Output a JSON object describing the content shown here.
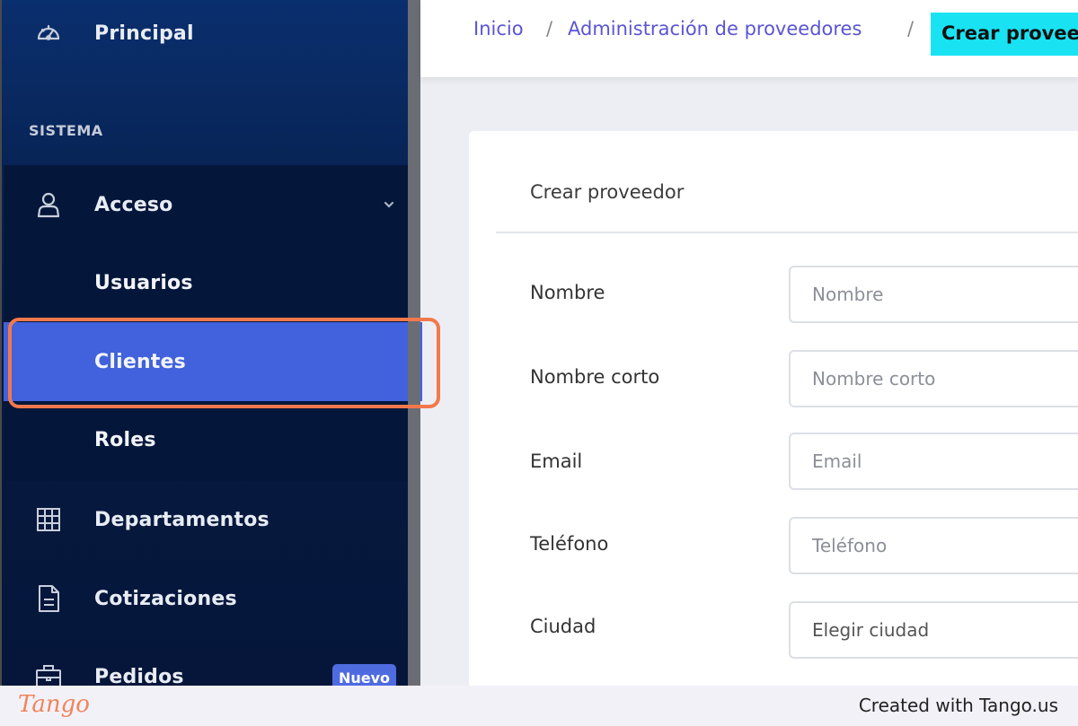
{
  "sidebar": {
    "items": {
      "principal": {
        "label": "Principal",
        "icon": "dashboard-gauge-icon"
      },
      "section": "SISTEMA",
      "acceso": {
        "label": "Acceso",
        "icon": "user-icon"
      },
      "usuarios": {
        "label": "Usuarios"
      },
      "clientes": {
        "label": "Clientes"
      },
      "roles": {
        "label": "Roles"
      },
      "departamentos": {
        "label": "Departamentos",
        "icon": "grid-icon"
      },
      "cotizaciones": {
        "label": "Cotizaciones",
        "icon": "document-icon"
      },
      "pedidos": {
        "label": "Pedidos",
        "icon": "briefcase-icon",
        "badge": "Nuevo"
      }
    },
    "colors": {
      "active": "#4162dc",
      "highlight": "#f3784c"
    }
  },
  "breadcrumb": {
    "home": "Inicio",
    "section": "Administración de proveedores",
    "current": "Crear proveedor",
    "separator": "/"
  },
  "form": {
    "title": "Crear proveedor",
    "fields": {
      "nombre": {
        "label": "Nombre",
        "placeholder": "Nombre"
      },
      "nombre_corto": {
        "label": "Nombre corto",
        "placeholder": "Nombre corto"
      },
      "email": {
        "label": "Email",
        "placeholder": "Email"
      },
      "telefono": {
        "label": "Teléfono",
        "placeholder": "Teléfono"
      },
      "ciudad": {
        "label": "Ciudad",
        "placeholder": "Elegir ciudad"
      }
    }
  },
  "footer": {
    "logo": "Tango",
    "credit": "Created with Tango.us"
  }
}
